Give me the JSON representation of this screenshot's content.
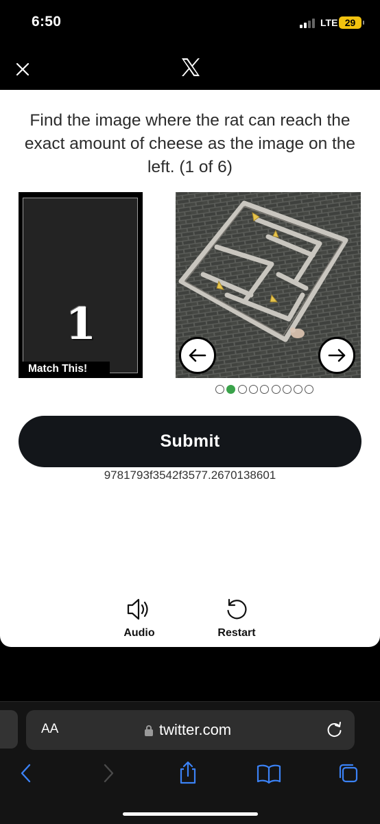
{
  "status_bar": {
    "time": "6:50",
    "network": "LTE",
    "battery": "29"
  },
  "header": {
    "logo": "X"
  },
  "challenge": {
    "prompt": "Find the image where the rat can reach the exact amount of cheese as the image on the left. (1 of 6)",
    "match_number": "1",
    "match_label": "Match This!",
    "carousel": {
      "total_dots": 9,
      "active_index": 1
    },
    "submit_label": "Submit",
    "session_id": "9781793f3542f3577.2670138601",
    "audio_label": "Audio",
    "restart_label": "Restart"
  },
  "browser": {
    "text_size_label": "AA",
    "url": "twitter.com"
  },
  "colors": {
    "card_bg": "#ffffff",
    "submit_bg": "#13161a",
    "active_dot": "#3aa34a",
    "battery": "#f2c20f"
  }
}
